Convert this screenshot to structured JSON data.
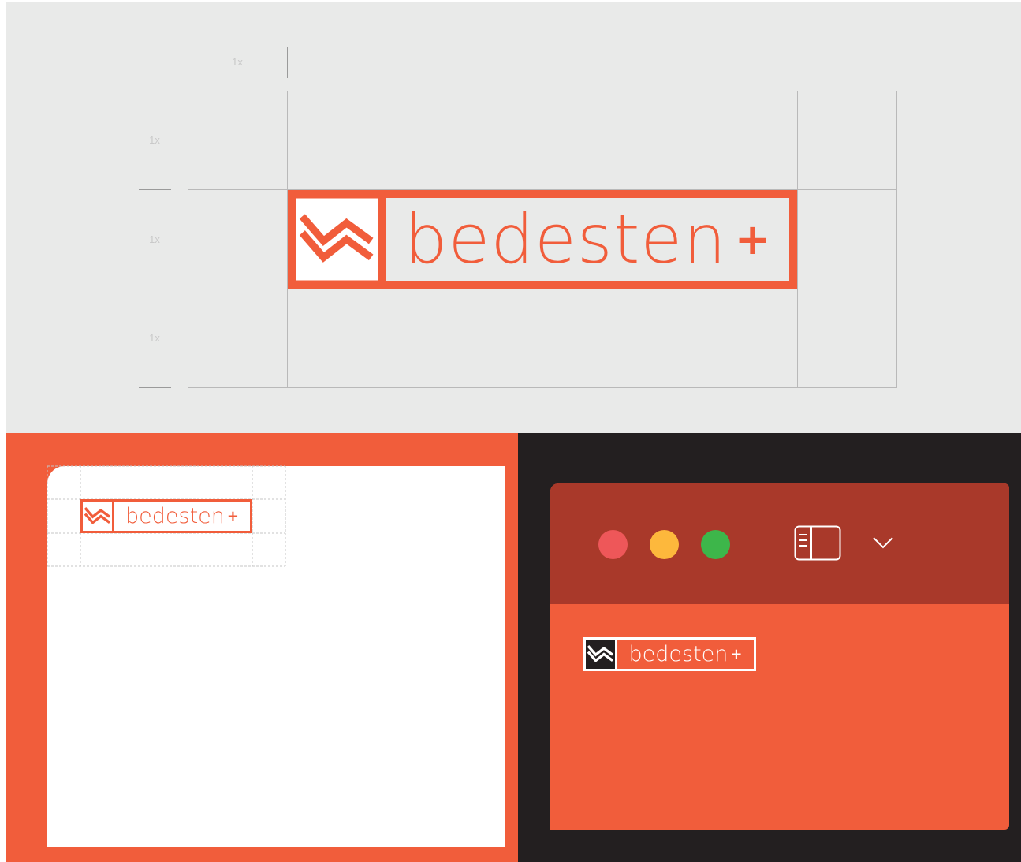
{
  "colors": {
    "brand_orange": "#f15d3b",
    "panel_gray": "#e9eae9",
    "grid_line": "#b9b9b9",
    "dark": "#231f20",
    "titlebar": "#a9392a",
    "traffic_red": "#ee5759",
    "traffic_yellow": "#fdb83c",
    "traffic_green": "#3db64a"
  },
  "brand": {
    "wordmark": "bedesten",
    "plus": "+"
  },
  "clearspace": {
    "unit_label": "1x",
    "row_labels": [
      "1x",
      "1x",
      "1x"
    ]
  },
  "window": {
    "traffic_lights": [
      "close",
      "minimize",
      "zoom"
    ],
    "icons": [
      "sidebar-icon",
      "chevron-down-icon"
    ]
  }
}
